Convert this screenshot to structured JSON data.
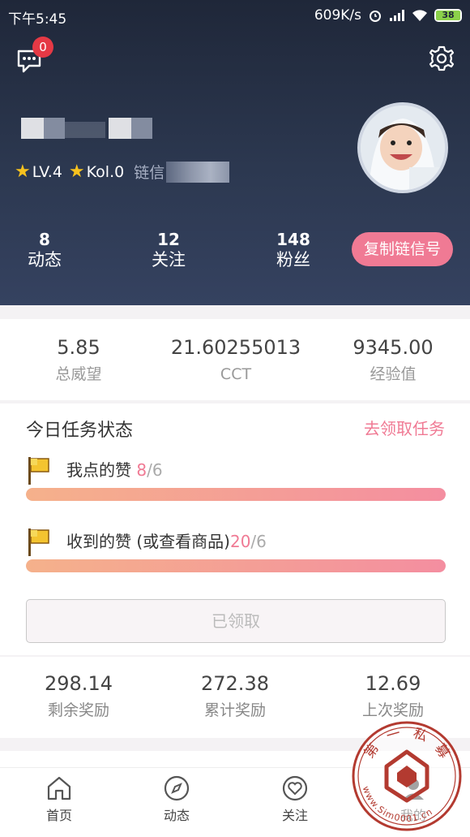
{
  "status_bar": {
    "time": "下午5:45",
    "speed": "609K/s",
    "battery": "38"
  },
  "header": {
    "message_badge": "0",
    "levels": {
      "lv": "LV.4",
      "kol": "Kol.0",
      "chain_prefix": "链信"
    },
    "stats": [
      {
        "num": "8",
        "label": "动态"
      },
      {
        "num": "12",
        "label": "关注"
      },
      {
        "num": "148",
        "label": "粉丝"
      }
    ],
    "copy_button": "复制链信号"
  },
  "summary": [
    {
      "num": "5.85",
      "label": "总威望"
    },
    {
      "num": "21.60255013",
      "label": "CCT"
    },
    {
      "num": "9345.00",
      "label": "经验值"
    }
  ],
  "tasks": {
    "title": "今日任务状态",
    "link": "去领取任务",
    "items": [
      {
        "label": "我点的赞 ",
        "current": "8",
        "total": "/6",
        "progress": 1.0
      },
      {
        "label": "收到的赞 (或查看商品)",
        "current": "20",
        "total": "/6",
        "progress": 1.0
      }
    ],
    "claimed_button": "已领取"
  },
  "rewards": [
    {
      "num": "298.14",
      "label": "剩余奖励"
    },
    {
      "num": "272.38",
      "label": "累计奖励"
    },
    {
      "num": "12.69",
      "label": "上次奖励"
    }
  ],
  "tabbar": [
    {
      "label": "首页",
      "icon": "home-icon"
    },
    {
      "label": "动态",
      "icon": "compass-icon"
    },
    {
      "label": "关注",
      "icon": "heart-icon"
    },
    {
      "label": "我的",
      "icon": "user-icon"
    }
  ],
  "watermark": {
    "text_top": "第一私募",
    "text_bottom": "www.Sim0001.cn"
  }
}
